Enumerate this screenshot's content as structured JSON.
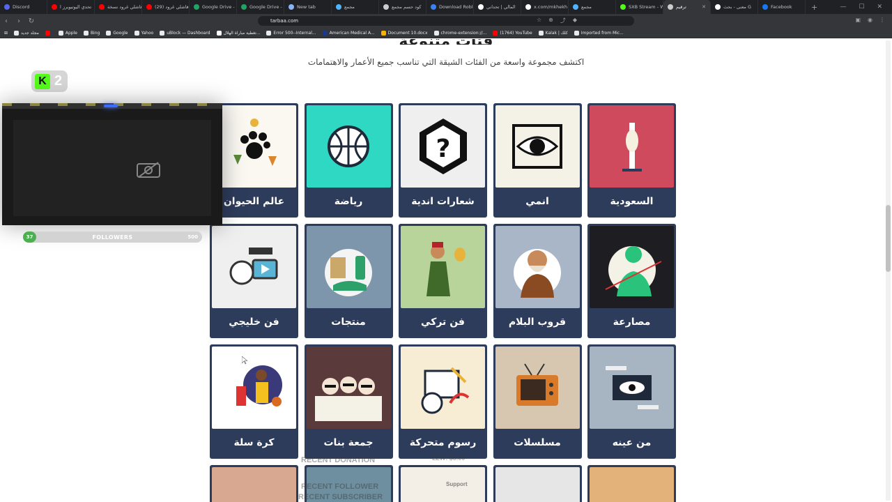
{
  "browser": {
    "tabs": [
      {
        "label": "Discord",
        "color": "#5865f2"
      },
      {
        "label": "تحدي اليوتيوبرز ا",
        "color": "#ff0000"
      },
      {
        "label": "فاشلي غرود نسخة",
        "color": "#ff0000"
      },
      {
        "label": "(29) فاشلي غرود",
        "color": "#ff0000"
      },
      {
        "label": "Google Drive -",
        "color": "#1fa463"
      },
      {
        "label": "Google Drive -",
        "color": "#1fa463"
      },
      {
        "label": "New tab",
        "color": "#8ab4f8"
      },
      {
        "label": "مجمع",
        "color": "#4fb3ff"
      },
      {
        "label": "كود حسم مجمع",
        "color": "#cccccc"
      },
      {
        "label": "Download Roblo",
        "color": "#3b82f6"
      },
      {
        "label": "المالي | تحداني",
        "color": "#ffffff"
      },
      {
        "label": "x.com/mkhekh",
        "color": "#ffffff"
      },
      {
        "label": "مجمع",
        "color": "#4fb3ff"
      },
      {
        "label": "SXB Stream - W",
        "color": "#53fc18"
      },
      {
        "label": "ترقيم",
        "color": "#cccccc",
        "active": true
      },
      {
        "label": "معنى - بحث G",
        "color": "#ffffff"
      },
      {
        "label": "Facebook",
        "color": "#1877f2"
      }
    ],
    "url": "tarbaa.com",
    "bookmarks": [
      {
        "label": "مجلد جديد",
        "color": "#e8eaed"
      },
      {
        "label": "",
        "color": "#ff0000"
      },
      {
        "label": "Apple",
        "color": "#e8eaed"
      },
      {
        "label": "Bing",
        "color": "#e8eaed"
      },
      {
        "label": "Google",
        "color": "#e8eaed"
      },
      {
        "label": "Yahoo",
        "color": "#e8eaed"
      },
      {
        "label": "uBlock — Dashboard",
        "color": "#e8eaed"
      },
      {
        "label": "تغطية مباراة الهلال...",
        "color": "#ffffff"
      },
      {
        "label": "Error 500--Internal...",
        "color": "#e8eaed"
      },
      {
        "label": "American Medical A...",
        "color": "#1a3a8a"
      },
      {
        "label": "Document 10.docx",
        "color": "#f6b400"
      },
      {
        "label": "chrome-extension://...",
        "color": "#e8eaed"
      },
      {
        "label": "(1764) YouTube",
        "color": "#ff0000"
      },
      {
        "label": "Kalak | كلك",
        "color": "#e8eaed"
      },
      {
        "label": "Imported from Mic...",
        "color": "#e8eaed"
      }
    ]
  },
  "page": {
    "title": "فئات متنوعة",
    "subtitle": "اكتشف مجموعة واسعة من الفئات الشيقة التي تناسب جميع الأعمار والاهتمامات",
    "categories": [
      {
        "label": "السعودية",
        "bg": "#cf4a5c",
        "icon": "tower-icon"
      },
      {
        "label": "انمي",
        "bg": "#f4f1e6",
        "icon": "eye-icon"
      },
      {
        "label": "شعارات اندية",
        "bg": "#efefef",
        "icon": "question-icon"
      },
      {
        "label": "رياضة",
        "bg": "#2ed8c3",
        "icon": "ball-icon"
      },
      {
        "label": "عالم الحيوان",
        "bg": "#faf8f1",
        "icon": "paw-icon"
      },
      {
        "label": "مصارعة",
        "bg": "#1e1e22",
        "icon": "wrestler-icon"
      },
      {
        "label": "قروب البلام",
        "bg": "#a9b6c8",
        "icon": "elder-icon"
      },
      {
        "label": "فن تركي",
        "bg": "#b8d49b",
        "icon": "turkish-art-icon"
      },
      {
        "label": "منتجات",
        "bg": "#7e96ab",
        "icon": "products-icon"
      },
      {
        "label": "فن خليجي",
        "bg": "#efefef",
        "icon": "film-icon"
      },
      {
        "label": "من عينه",
        "bg": "#a7b4c2",
        "icon": "eye-hand-icon"
      },
      {
        "label": "مسلسلات",
        "bg": "#d8c7b0",
        "icon": "tv-icon"
      },
      {
        "label": "رسوم متحركة",
        "bg": "#f7ecd4",
        "icon": "animation-icon"
      },
      {
        "label": "جمعة بنات",
        "bg": "#5a3a3a",
        "icon": "girls-icon"
      },
      {
        "label": "كرة سلة",
        "bg": "#ffffff",
        "icon": "basketball-icon"
      }
    ],
    "partial_row": [
      {
        "bg": "#e2b27a"
      },
      {
        "bg": "#e6e6e6"
      },
      {
        "bg": "#f3efe6"
      },
      {
        "bg": "#6e8fa0"
      },
      {
        "bg": "#d8a890"
      }
    ]
  },
  "overlay": {
    "kick_viewers": "2",
    "followers": {
      "current": "37",
      "label": "FOLLOWERS",
      "goal": "500",
      "progress": 0.074
    },
    "recent_donation": "RECENT DONATION",
    "donation_amount": "ΣΖW: $5.00",
    "recent_follower": "RECENT FOLLOWER",
    "recent_subscriber": "RECENT SUBSCRIBER",
    "support": "Support"
  }
}
